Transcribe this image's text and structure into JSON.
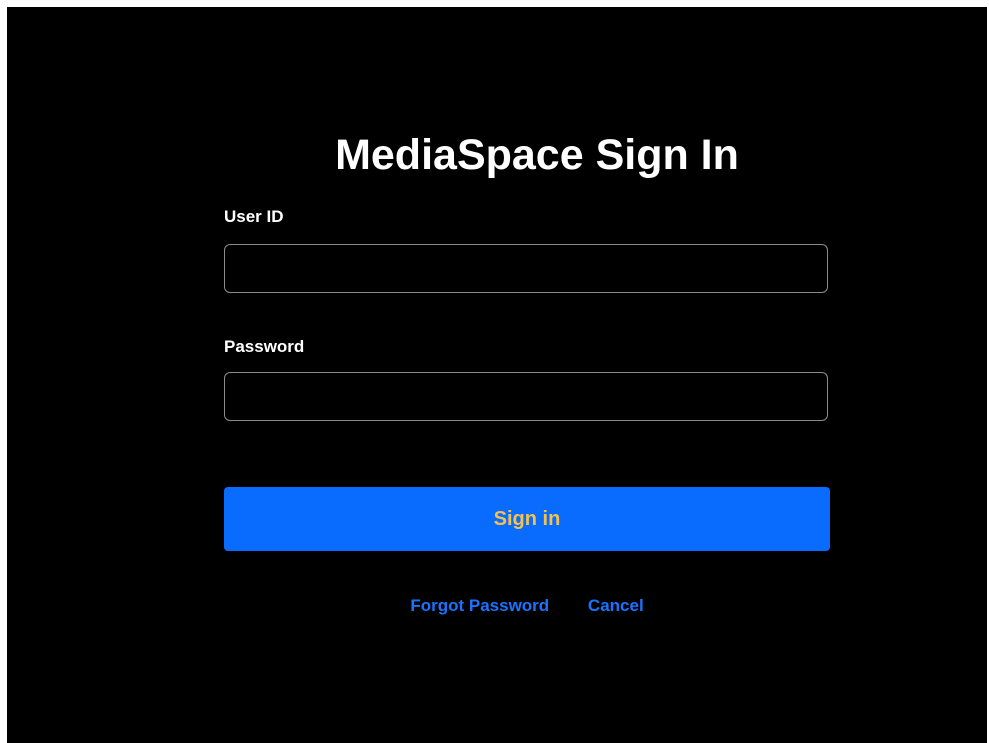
{
  "page": {
    "title": "MediaSpace Sign In"
  },
  "form": {
    "user_id_label": "User ID",
    "user_id_value": "",
    "password_label": "Password",
    "password_value": "",
    "sign_in_label": "Sign in"
  },
  "links": {
    "forgot_password": "Forgot Password",
    "cancel": "Cancel"
  },
  "colors": {
    "background": "#000000",
    "primary_button": "#0a6bff",
    "button_text": "#f2c14e",
    "link": "#1a73ff"
  }
}
